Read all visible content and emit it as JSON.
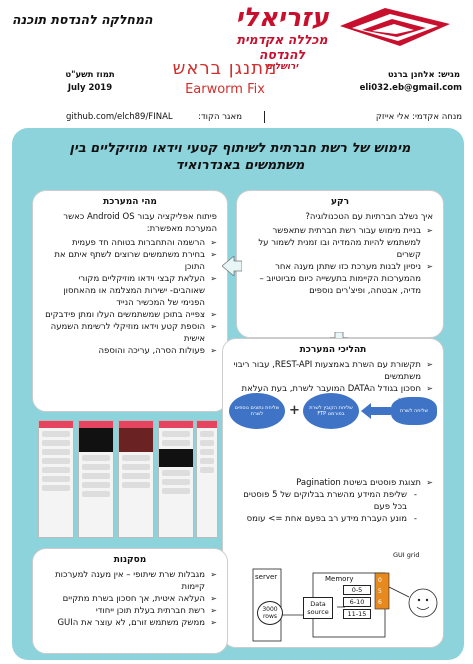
{
  "header": {
    "college": {
      "name": "עזריאלי",
      "subtitle": "מכללה אקדמית להנדסה",
      "city": "ירושלים"
    },
    "department": "המחלקה להנדסת תוכנה",
    "submitter_label": "מגיש: אלחנן ברנט",
    "submitter_email": "eli032.eb@gmail.com",
    "project_name_he": "מתנגן בראש",
    "project_name_en": "Earworm Fix",
    "date_he": "תמוז תשע\"ט",
    "date_en": "July 2019",
    "advisor": "מנחה אקדמי: אלי אייזק",
    "code_source_label": "מאגר הקוד:",
    "github_url": "github.com/elch89/FINAL"
  },
  "main_title": "מימוש של רשת חברתית לשיתוף קטעי וידאו מוזיקליים בין משתמשים באנדרואיד",
  "background": {
    "title": "רקע",
    "intro": "איך נשלב חברתיות עם הטכנולוגיה?",
    "bullets": [
      "בניית מימוש עבור רשת חברתית שתאפשר למשתמש להיות מהמדיה ובו זמנית לשמור על קשרים",
      "ניסיון לבנות מערכת כזו שתתן מענה אחר מהמערכות הקיימות בתעשייה כיום מביוטיוב – מדיה, אבטחה, ופיצ'רים נוספים"
    ]
  },
  "product": {
    "title": "מהי המערכת",
    "intro": "פיתוח אפליקציה עבור Android OS כאשר המערכת מאפשרת:",
    "bullets": [
      "הרשמה והתחברות בטוחה חד פעמית",
      "בחירת משתמשים שרוצים לשתף איתם את התוכן",
      "העלאת קבצי וידאו מוזיקליים מקורי שאוהבים- ישירות המצלמה או מהאחסון הפנימי של המכשיר הנייד",
      "צפייה בתוכן שמשתמשים העלו ומתן פידבקים",
      "הוספת קטע וידאו מוזיקלי לרשימת השמעה אישית",
      "פעולות הסרה, עריכה והוספה"
    ]
  },
  "process": {
    "title": "תהליכי המערכת",
    "bullets": [
      "תקשורת עם השרת באמצעות REST-API, עבור ריבוי משתמשים",
      "חסכון בגודל הDATA המועבר לשרת, בעת העלאת סרטון:"
    ],
    "flow": {
      "server_label": "שליחה לשרת",
      "zip_label": "שליחת הקובץ לשרת בפורמט FTP",
      "meta_label": "שליחת נתונים נוספים לשרת",
      "plus": "+"
    },
    "pagination_bullet": "תצוגת פוסטים בשיטת Pagination",
    "sub_bullets": [
      "שליפת המידע מהשרת בבלוקים של 5 פוסטים בכל פעם",
      "מונע העברת מידע רב בפעם אחת => עומס"
    ],
    "diagram": {
      "gui_label": "GUI grid",
      "server_label": "server",
      "rows_label": "3000 rows",
      "datasource_label": "Data source",
      "memory_label": "Memory",
      "memory_cells": [
        "0-5",
        "6-10",
        "11-15"
      ],
      "index_cells": [
        "0",
        "5",
        "6"
      ]
    }
  },
  "conclusions": {
    "title": "מסקנות",
    "bullets": [
      "מגבלות שרת שיתופי – אין מענה למערכות קיימות",
      "העלאה איטית, אך חסכון בשרת מתקיים",
      "רשת חברתית בעלת תוכן ייחודי",
      "ממשק משתמש זורם, לא עוצר את הGUI"
    ]
  },
  "colors": {
    "accent_red": "#c8102e",
    "panel_teal": "#8cd3dc",
    "flow_blue": "#3f73c6"
  }
}
